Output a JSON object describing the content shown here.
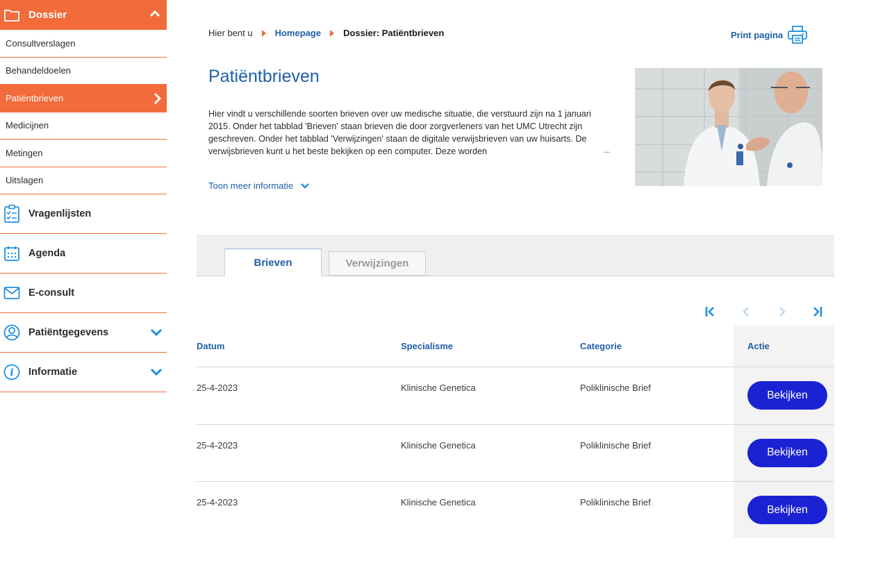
{
  "sidebar": {
    "section_title": "Dossier",
    "sub_items": [
      {
        "label": "Consultverslagen",
        "active": false
      },
      {
        "label": "Behandeldoelen",
        "active": false
      },
      {
        "label": "Patiëntbrieven",
        "active": true
      },
      {
        "label": "Medicijnen",
        "active": false
      },
      {
        "label": "Metingen",
        "active": false
      },
      {
        "label": "Uitslagen",
        "active": false
      }
    ],
    "main_items": [
      {
        "label": "Vragenlijsten",
        "icon": "clipboard-icon"
      },
      {
        "label": "Agenda",
        "icon": "calendar-icon"
      },
      {
        "label": "E-consult",
        "icon": "envelope-icon"
      },
      {
        "label": "Patiëntgegevens",
        "icon": "user-icon",
        "expandable": true
      },
      {
        "label": "Informatie",
        "icon": "info-icon",
        "expandable": true
      }
    ]
  },
  "breadcrumb": {
    "prefix": "Hier bent u",
    "home": "Homepage",
    "current": "Dossier: Patiëntbrieven"
  },
  "print_label": "Print pagina",
  "page_title": "Patiëntbrieven",
  "intro_text": "Hier vindt u verschillende soorten brieven over uw medische situatie, die verstuurd zijn na 1 januari 2015. Onder het tabblad 'Brieven' staan brieven die door zorgverleners van het UMC Utrecht zijn geschreven. Onder het tabblad 'Verwijzingen' staan de digitale verwijsbrieven van uw huisarts. De verwijsbrieven kunt u het beste bekijken op een computer. Deze worden",
  "intro_ellipsis": "...",
  "more_info": "Toon meer informatie",
  "tabs": [
    {
      "label": "Brieven",
      "active": true
    },
    {
      "label": "Verwijzingen",
      "active": false
    }
  ],
  "table": {
    "headers": {
      "datum": "Datum",
      "specialisme": "Specialisme",
      "categorie": "Categorie",
      "actie": "Actie"
    },
    "rows": [
      {
        "datum": "25-4-2023",
        "specialisme": "Klinische Genetica",
        "categorie": "Poliklinische Brief",
        "action": "Bekijken"
      },
      {
        "datum": "25-4-2023",
        "specialisme": "Klinische Genetica",
        "categorie": "Poliklinische Brief",
        "action": "Bekijken"
      },
      {
        "datum": "25-4-2023",
        "specialisme": "Klinische Genetica",
        "categorie": "Poliklinische Brief",
        "action": "Bekijken"
      }
    ]
  },
  "colors": {
    "accent": "#f26b3a",
    "link": "#1f5fa8",
    "button": "#1b22d4"
  }
}
